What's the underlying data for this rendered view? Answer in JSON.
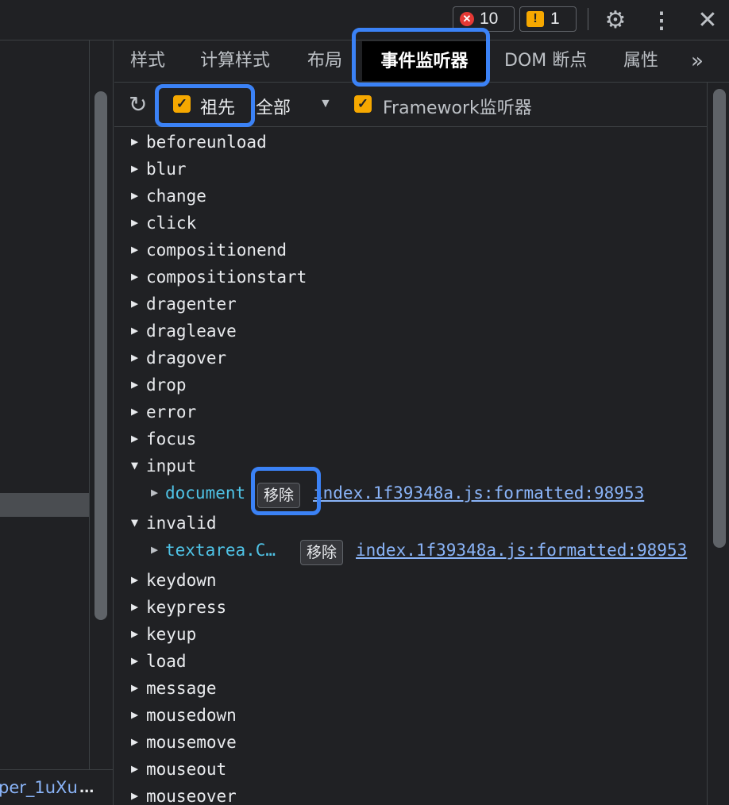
{
  "topbar": {
    "error_count": "10",
    "error_icon": "✕",
    "warning_count": "1",
    "warning_icon": "!",
    "settings_icon": "⚙",
    "more_icon": "⋮",
    "close_icon": "✕"
  },
  "tabs": {
    "styles": "样式",
    "computed": "计算样式",
    "layout": "布局",
    "event_listeners": "事件监听器",
    "dom_breakpoints": "DOM 断点",
    "properties": "属性",
    "overflow": "»"
  },
  "toolbar": {
    "refresh_icon": "↻",
    "ancestors_label": "祖先",
    "ancestors_checked": true,
    "filter_value": "全部",
    "filter_arrow": "▼",
    "framework_label": "Framework监听器",
    "framework_checked": true,
    "check_mark": "✓"
  },
  "left_pane": {
    "crumb": "per_1uXu",
    "ellipsis": "..."
  },
  "events": [
    "beforeunload",
    "blur",
    "change",
    "click",
    "compositionend",
    "compositionstart",
    "dragenter",
    "dragleave",
    "dragover",
    "drop",
    "error",
    "focus",
    "input",
    "invalid",
    "keydown",
    "keypress",
    "keyup",
    "load",
    "message",
    "mousedown",
    "mousemove",
    "mouseout",
    "mouseover"
  ],
  "expanded": {
    "input": {
      "node": "document",
      "remove_label": "移除",
      "source": "index.1f39348a.js:formatted:98953"
    },
    "invalid": {
      "node": "textarea.C…",
      "remove_label": "移除",
      "source": "index.1f39348a.js:formatted:98953"
    }
  },
  "colors": {
    "background": "#202124",
    "highlight": "#3b82f6",
    "checkbox": "#f6a800",
    "link": "#8ab4f8",
    "node": "#4fc3e6"
  }
}
